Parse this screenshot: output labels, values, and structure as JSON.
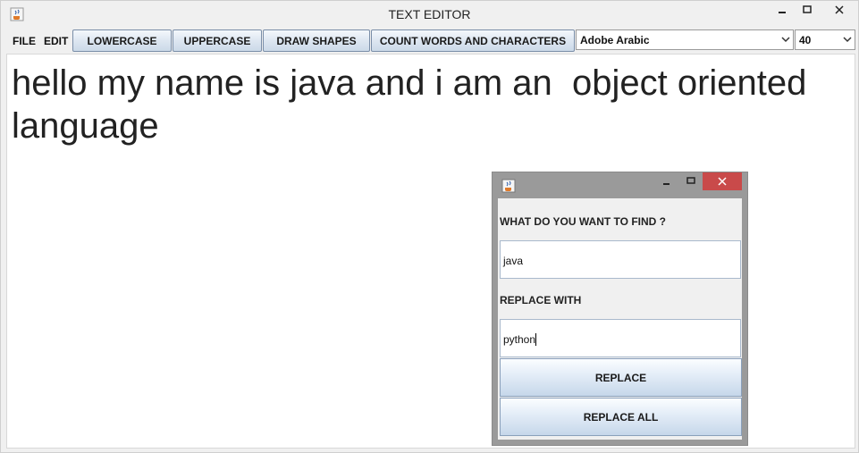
{
  "window": {
    "title": "TEXT EDITOR",
    "icon": "java-cup-icon"
  },
  "menu": {
    "file_label": "FILE",
    "edit_label": "EDIT"
  },
  "toolbar": {
    "lowercase_label": "LOWERCASE",
    "uppercase_label": "UPPERCASE",
    "draw_shapes_label": "DRAW SHAPES",
    "count_label": "COUNT WORDS AND CHARACTERS",
    "font_select_value": "Adobe Arabic",
    "size_select_value": "40"
  },
  "editor": {
    "text": "hello my name is java and i am an  object oriented language"
  },
  "dialog": {
    "find_label": "WHAT DO YOU WANT TO FIND ?",
    "find_value": "java",
    "replace_label": "REPLACE WITH",
    "replace_value": "python",
    "replace_button": "REPLACE",
    "replace_all_button": "REPLACE ALL"
  },
  "colors": {
    "close_button": "#c94a4a",
    "button_border": "#7a8ea8"
  }
}
